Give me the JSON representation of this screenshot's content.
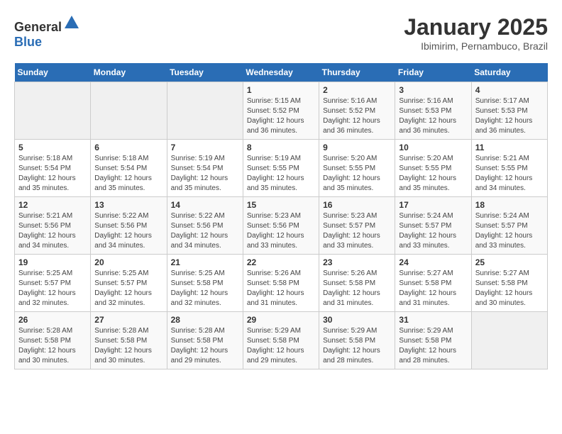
{
  "header": {
    "logo_general": "General",
    "logo_blue": "Blue",
    "title": "January 2025",
    "subtitle": "Ibimirim, Pernambuco, Brazil"
  },
  "days_of_week": [
    "Sunday",
    "Monday",
    "Tuesday",
    "Wednesday",
    "Thursday",
    "Friday",
    "Saturday"
  ],
  "weeks": [
    [
      {
        "day": "",
        "info": ""
      },
      {
        "day": "",
        "info": ""
      },
      {
        "day": "",
        "info": ""
      },
      {
        "day": "1",
        "info": "Sunrise: 5:15 AM\nSunset: 5:52 PM\nDaylight: 12 hours\nand 36 minutes."
      },
      {
        "day": "2",
        "info": "Sunrise: 5:16 AM\nSunset: 5:52 PM\nDaylight: 12 hours\nand 36 minutes."
      },
      {
        "day": "3",
        "info": "Sunrise: 5:16 AM\nSunset: 5:53 PM\nDaylight: 12 hours\nand 36 minutes."
      },
      {
        "day": "4",
        "info": "Sunrise: 5:17 AM\nSunset: 5:53 PM\nDaylight: 12 hours\nand 36 minutes."
      }
    ],
    [
      {
        "day": "5",
        "info": "Sunrise: 5:18 AM\nSunset: 5:54 PM\nDaylight: 12 hours\nand 35 minutes."
      },
      {
        "day": "6",
        "info": "Sunrise: 5:18 AM\nSunset: 5:54 PM\nDaylight: 12 hours\nand 35 minutes."
      },
      {
        "day": "7",
        "info": "Sunrise: 5:19 AM\nSunset: 5:54 PM\nDaylight: 12 hours\nand 35 minutes."
      },
      {
        "day": "8",
        "info": "Sunrise: 5:19 AM\nSunset: 5:55 PM\nDaylight: 12 hours\nand 35 minutes."
      },
      {
        "day": "9",
        "info": "Sunrise: 5:20 AM\nSunset: 5:55 PM\nDaylight: 12 hours\nand 35 minutes."
      },
      {
        "day": "10",
        "info": "Sunrise: 5:20 AM\nSunset: 5:55 PM\nDaylight: 12 hours\nand 35 minutes."
      },
      {
        "day": "11",
        "info": "Sunrise: 5:21 AM\nSunset: 5:55 PM\nDaylight: 12 hours\nand 34 minutes."
      }
    ],
    [
      {
        "day": "12",
        "info": "Sunrise: 5:21 AM\nSunset: 5:56 PM\nDaylight: 12 hours\nand 34 minutes."
      },
      {
        "day": "13",
        "info": "Sunrise: 5:22 AM\nSunset: 5:56 PM\nDaylight: 12 hours\nand 34 minutes."
      },
      {
        "day": "14",
        "info": "Sunrise: 5:22 AM\nSunset: 5:56 PM\nDaylight: 12 hours\nand 34 minutes."
      },
      {
        "day": "15",
        "info": "Sunrise: 5:23 AM\nSunset: 5:56 PM\nDaylight: 12 hours\nand 33 minutes."
      },
      {
        "day": "16",
        "info": "Sunrise: 5:23 AM\nSunset: 5:57 PM\nDaylight: 12 hours\nand 33 minutes."
      },
      {
        "day": "17",
        "info": "Sunrise: 5:24 AM\nSunset: 5:57 PM\nDaylight: 12 hours\nand 33 minutes."
      },
      {
        "day": "18",
        "info": "Sunrise: 5:24 AM\nSunset: 5:57 PM\nDaylight: 12 hours\nand 33 minutes."
      }
    ],
    [
      {
        "day": "19",
        "info": "Sunrise: 5:25 AM\nSunset: 5:57 PM\nDaylight: 12 hours\nand 32 minutes."
      },
      {
        "day": "20",
        "info": "Sunrise: 5:25 AM\nSunset: 5:57 PM\nDaylight: 12 hours\nand 32 minutes."
      },
      {
        "day": "21",
        "info": "Sunrise: 5:25 AM\nSunset: 5:58 PM\nDaylight: 12 hours\nand 32 minutes."
      },
      {
        "day": "22",
        "info": "Sunrise: 5:26 AM\nSunset: 5:58 PM\nDaylight: 12 hours\nand 31 minutes."
      },
      {
        "day": "23",
        "info": "Sunrise: 5:26 AM\nSunset: 5:58 PM\nDaylight: 12 hours\nand 31 minutes."
      },
      {
        "day": "24",
        "info": "Sunrise: 5:27 AM\nSunset: 5:58 PM\nDaylight: 12 hours\nand 31 minutes."
      },
      {
        "day": "25",
        "info": "Sunrise: 5:27 AM\nSunset: 5:58 PM\nDaylight: 12 hours\nand 30 minutes."
      }
    ],
    [
      {
        "day": "26",
        "info": "Sunrise: 5:28 AM\nSunset: 5:58 PM\nDaylight: 12 hours\nand 30 minutes."
      },
      {
        "day": "27",
        "info": "Sunrise: 5:28 AM\nSunset: 5:58 PM\nDaylight: 12 hours\nand 30 minutes."
      },
      {
        "day": "28",
        "info": "Sunrise: 5:28 AM\nSunset: 5:58 PM\nDaylight: 12 hours\nand 29 minutes."
      },
      {
        "day": "29",
        "info": "Sunrise: 5:29 AM\nSunset: 5:58 PM\nDaylight: 12 hours\nand 29 minutes."
      },
      {
        "day": "30",
        "info": "Sunrise: 5:29 AM\nSunset: 5:58 PM\nDaylight: 12 hours\nand 28 minutes."
      },
      {
        "day": "31",
        "info": "Sunrise: 5:29 AM\nSunset: 5:58 PM\nDaylight: 12 hours\nand 28 minutes."
      },
      {
        "day": "",
        "info": ""
      }
    ]
  ]
}
